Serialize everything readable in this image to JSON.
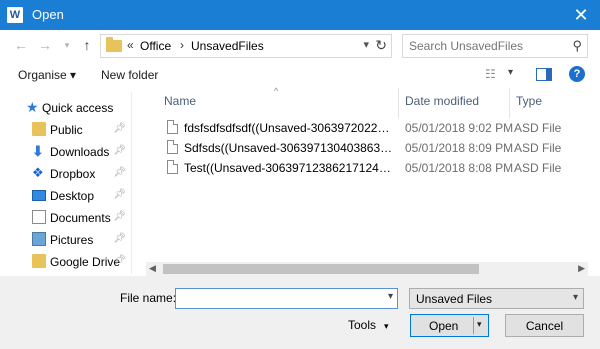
{
  "window": {
    "title": "Open",
    "app_icon": "word-icon",
    "app_icon_letter": "W",
    "close_glyph": "✕"
  },
  "address": {
    "overflow": "«",
    "crumbs": [
      "Office",
      "UnsavedFiles"
    ],
    "separator": "›",
    "search_placeholder": "Search UnsavedFiles"
  },
  "toolbar": {
    "organise": "Organise ▾",
    "new_folder": "New folder",
    "help": "?"
  },
  "sidebar": {
    "quick_access": "Quick access",
    "items": [
      {
        "label": "Public",
        "icon": "folder-icon",
        "pinned": true
      },
      {
        "label": "Downloads",
        "icon": "download-icon",
        "pinned": true
      },
      {
        "label": "Dropbox",
        "icon": "dropbox-icon",
        "pinned": true
      },
      {
        "label": "Desktop",
        "icon": "desktop-icon",
        "pinned": true
      },
      {
        "label": "Documents",
        "icon": "documents-icon",
        "pinned": true
      },
      {
        "label": "Pictures",
        "icon": "pictures-icon",
        "pinned": true
      },
      {
        "label": "Google Drive",
        "icon": "folder-icon",
        "pinned": true
      }
    ]
  },
  "columns": {
    "name": "Name",
    "date": "Date modified",
    "type": "Type"
  },
  "files": [
    {
      "name": "fdsfsdfsdfsdf((Unsaved-306397202225682...",
      "date": "05/01/2018 9:02 PM",
      "type": "ASD File"
    },
    {
      "name": "Sdfsds((Unsaved-306397130403863952)).a...",
      "date": "05/01/2018 8:09 PM",
      "type": "ASD File"
    },
    {
      "name": "Test((Unsaved-306397123862171248)).asd",
      "date": "05/01/2018 8:08 PM",
      "type": "ASD File"
    }
  ],
  "bottom": {
    "file_name_label": "File name:",
    "file_name_value": "",
    "file_type": "Unsaved Files",
    "tools": "Tools",
    "open": "Open",
    "cancel": "Cancel"
  },
  "colors": {
    "titlebar": "#1a7fd4",
    "accent": "#0078d7",
    "folder": "#e8c25a"
  }
}
